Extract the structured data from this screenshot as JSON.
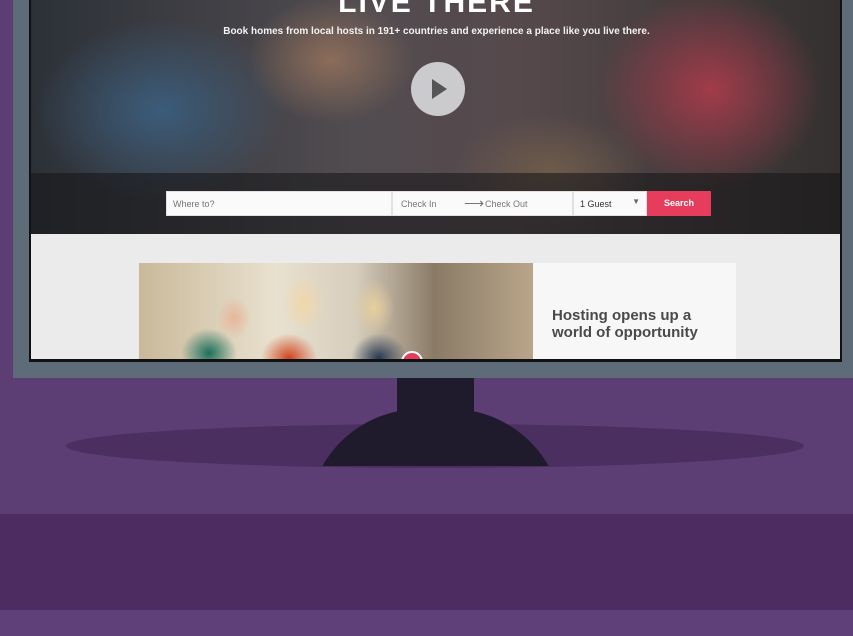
{
  "hero": {
    "title": "LIVE THERE",
    "subtitle": "Book homes from local hosts in 191+ countries and experience a place like you live there."
  },
  "search": {
    "where_placeholder": "Where to?",
    "check_in": "Check In",
    "check_out": "Check Out",
    "guests": "1 Guest",
    "search_label": "Search",
    "accent_color": "#e73d5c"
  },
  "promo": {
    "title": "Hosting opens up a world of opportunity"
  },
  "icons": {
    "play": "play-icon",
    "arrow": "arrow-right-icon",
    "dropdown": "chevron-down-icon"
  }
}
